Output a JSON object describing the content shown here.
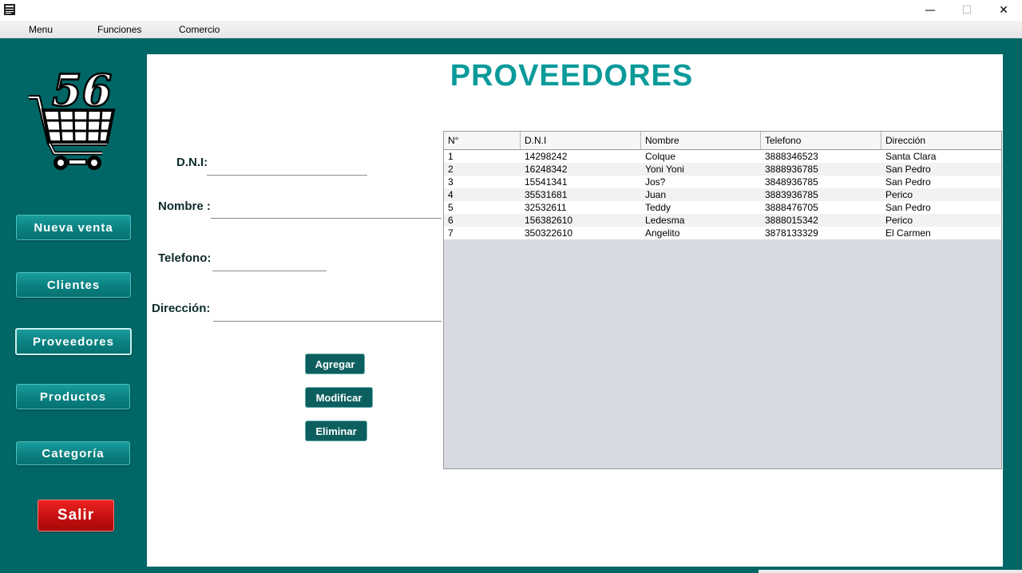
{
  "window": {
    "minimize_glyph": "—",
    "maximize_glyph": "☐",
    "close_glyph": "✕"
  },
  "menubar": {
    "items": [
      "Menu",
      "Funciones",
      "Comercio"
    ]
  },
  "logo": {
    "text": "56",
    "icon": "shopping-cart-icon"
  },
  "sidebar": {
    "nueva_venta": "Nueva venta",
    "clientes": "Clientes",
    "proveedores": "Proveedores",
    "productos": "Productos",
    "categoria": "Categoría",
    "salir": "Salir"
  },
  "page": {
    "title": "PROVEEDORES"
  },
  "form": {
    "dni_label": "D.N.I:",
    "nombre_label": "Nombre :",
    "telefono_label": "Telefono:",
    "direccion_label": "Dirección:",
    "agregar": "Agregar",
    "modificar": "Modificar",
    "eliminar": "Eliminar"
  },
  "table": {
    "headers": [
      "N°",
      "D.N.I",
      "Nombre",
      "Telefono",
      "Dirección"
    ],
    "rows": [
      [
        "1",
        "14298242",
        "Colque",
        "3888346523",
        "Santa Clara"
      ],
      [
        "2",
        "16248342",
        "Yoni Yoni",
        "3888936785",
        "San Pedro"
      ],
      [
        "3",
        "15541341",
        "Jos?",
        "3848936785",
        "San Pedro"
      ],
      [
        "4",
        "35531681",
        "Juan",
        "3883936785",
        "Perico"
      ],
      [
        "5",
        "32532611",
        "Teddy",
        "3888476705",
        "San Pedro"
      ],
      [
        "6",
        "156382610",
        "Ledesma",
        "3888015342",
        "Perico"
      ],
      [
        "7",
        "350322610",
        "Angelito",
        "3878133329",
        "El Carmen"
      ]
    ]
  },
  "colors": {
    "frame": "#006666",
    "title": "#0a9a9a",
    "nav_button": "#0b8080",
    "action_button": "#0d5f5f",
    "exit_button": "#c10f0f"
  }
}
